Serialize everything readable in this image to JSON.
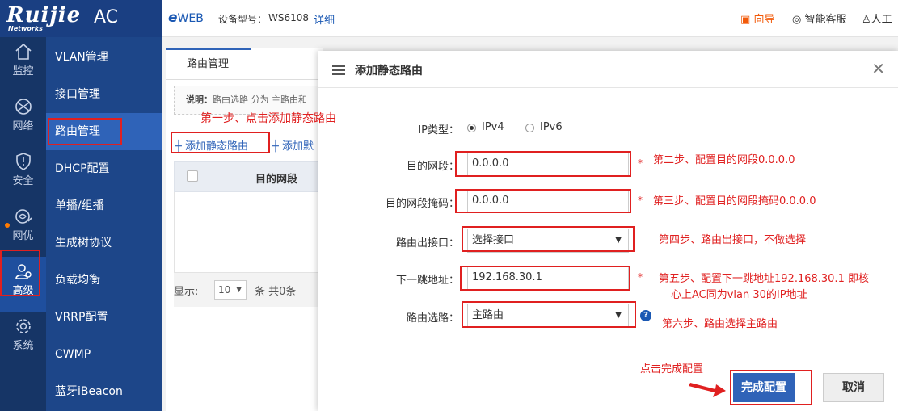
{
  "brand": {
    "logo": "Ruijie",
    "sub": "Networks",
    "product": "AC"
  },
  "topbar": {
    "eweb": "WEB",
    "model_label": "设备型号：",
    "model_value": "WS6108",
    "detail": "详细",
    "wizard": "向导",
    "service": "智能客服",
    "user": "人工"
  },
  "rail": {
    "items": [
      {
        "label": "监控",
        "icon": "home-icon"
      },
      {
        "label": "网络",
        "icon": "globe-icon"
      },
      {
        "label": "安全",
        "icon": "shield-icon"
      },
      {
        "label": "网优",
        "icon": "wifi-optimize-icon"
      },
      {
        "label": "高级",
        "icon": "users-icon"
      },
      {
        "label": "系统",
        "icon": "gear-icon"
      }
    ]
  },
  "submenu": {
    "items": [
      {
        "label": "VLAN管理"
      },
      {
        "label": "接口管理"
      },
      {
        "label": "路由管理"
      },
      {
        "label": "DHCP配置"
      },
      {
        "label": "单播/组播"
      },
      {
        "label": "生成树协议"
      },
      {
        "label": "负载均衡"
      },
      {
        "label": "VRRP配置"
      },
      {
        "label": "CWMP"
      },
      {
        "label": "蓝牙iBeacon"
      }
    ]
  },
  "content": {
    "tab": "路由管理",
    "note_label": "说明：",
    "note_text": "路由选路 分为 主路由和",
    "add_static": "添加静态路由",
    "add_other": "添加默",
    "col_dest": "目的网段",
    "pager_show": "显示:",
    "pager_size": "10",
    "pager_count": "条 共0条"
  },
  "modal": {
    "title": "添加静态路由",
    "ip_type_label": "IP类型：",
    "ipv4": "IPv4",
    "ipv6": "IPv6",
    "dest_label": "目的网段：",
    "dest_value": "0.0.0.0",
    "mask_label": "目的网段掩码：",
    "mask_value": "0.0.0.0",
    "iface_label": "路由出接口：",
    "iface_value": "选择接口",
    "nexthop_label": "下一跳地址：",
    "nexthop_value": "192.168.30.1",
    "route_label": "路由选路：",
    "route_value": "主路由",
    "ok": "完成配置",
    "cancel": "取消"
  },
  "annotations": {
    "step1": "第一步、点击添加静态路由",
    "step2": "第二步、配置目的网段0.0.0.0",
    "step3": "第三步、配置目的网段掩码0.0.0.0",
    "step4": "第四步、路由出接口，不做选择",
    "step5a": "第五步、配置下一跳地址192.168.30.1 即核",
    "step5b": "心上AC同为vlan 30的IP地址",
    "step6": "第六步、路由选择主路由",
    "finish": "点击完成配置"
  },
  "colors": {
    "brand_bg": "#1a3f82",
    "rail_bg": "#163566",
    "submenu_bg": "#1d4689",
    "accent": "#2f63b8",
    "annotation": "#e02020",
    "wizard": "#f25a0a"
  }
}
